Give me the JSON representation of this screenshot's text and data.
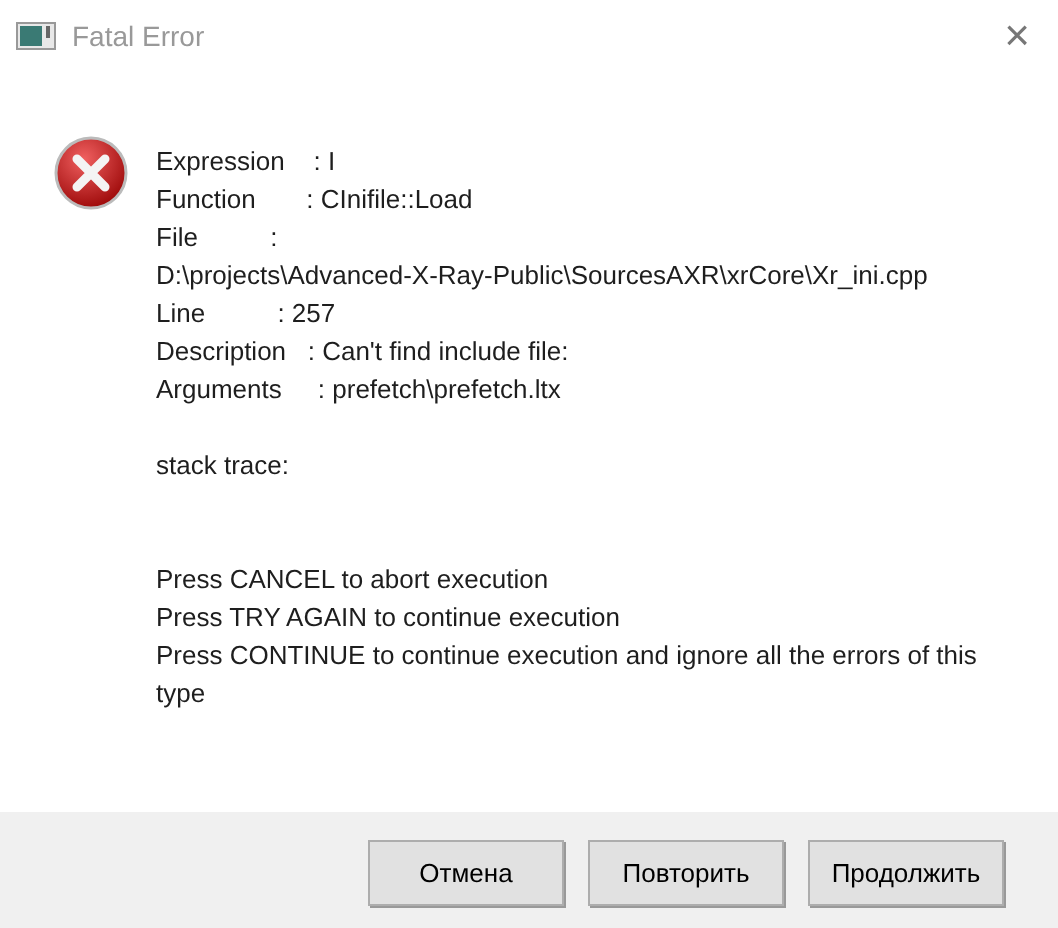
{
  "window": {
    "title": "Fatal Error",
    "close": "×"
  },
  "message": [
    {
      "lines": [
        "Expression    : I",
        "Function       : CInifile::Load",
        "File          :",
        "D:\\projects\\Advanced-X-Ray-Public\\SourcesAXR\\xrCore\\Xr_ini.cpp",
        "Line          : 257",
        "Description   : Can't find include file:",
        "Arguments     : prefetch\\prefetch.ltx"
      ]
    },
    {
      "lines": [
        "stack trace:"
      ]
    },
    {
      "lines": [
        "Press CANCEL to abort execution",
        "Press TRY AGAIN to continue execution",
        "Press CONTINUE to continue execution and ignore all the errors of this type"
      ]
    }
  ],
  "buttons": [
    "Отмена",
    "Повторить",
    "Продолжить"
  ]
}
